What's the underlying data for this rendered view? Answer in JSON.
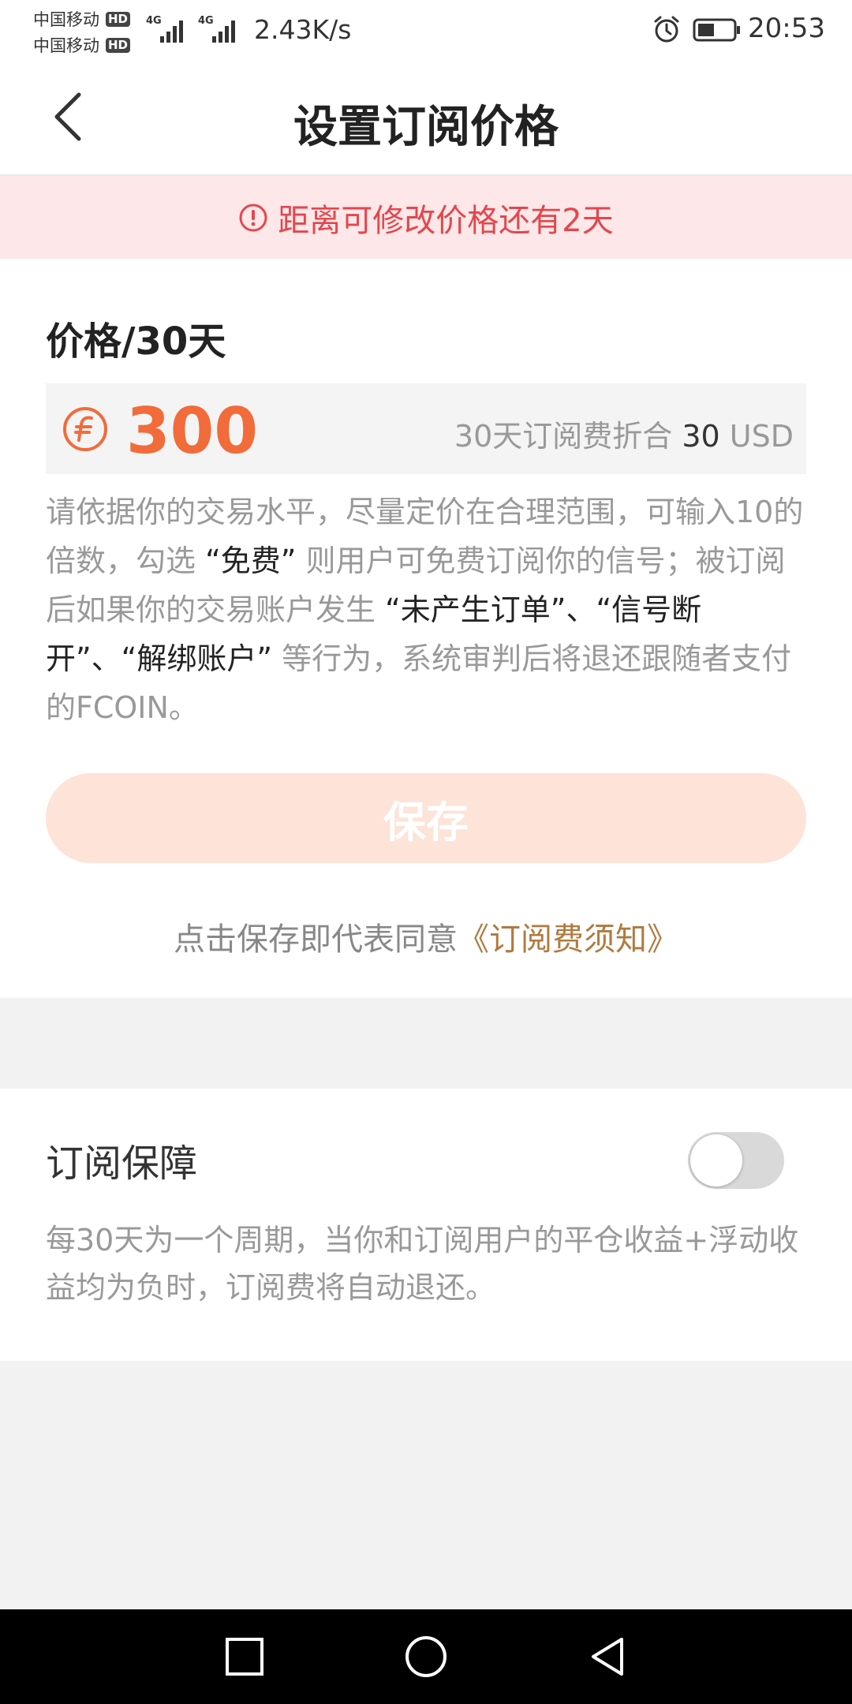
{
  "status_bar": {
    "carrier1": "中国移动",
    "carrier2": "中国移动",
    "hd_badge": "HD",
    "network": "4G",
    "net_speed": "2.43K/s",
    "time": "20:53",
    "icons": [
      "signal-icon",
      "alarm-icon",
      "battery-icon"
    ]
  },
  "header": {
    "title": "设置订阅价格",
    "back_icon": "chevron-left-icon"
  },
  "notice": {
    "text": "距离可修改价格还有2天",
    "icon": "exclamation-circle-icon",
    "color": "#e2474e"
  },
  "price": {
    "label": "价格/30天",
    "value": "300",
    "currency_icon": "fcoin-icon",
    "conversion_prefix": "30天订阅费折合 ",
    "conversion_amount": "30",
    "conversion_unit": " USD",
    "accent": "#f26b3a"
  },
  "description": {
    "p1": "请依据你的交易水平，尽量定价在合理范围，可输入10的倍数，勾选 ",
    "free": "“免费”",
    "p2": " 则用户可免费订阅你的信号；被订阅后如果你的交易账户发生 ",
    "conditions": "“未产生订单”、“信号断开”、“解绑账户”",
    "p3": " 等行为，系统审判后将退还跟随者支付的FCOIN。"
  },
  "save": {
    "label": "保存"
  },
  "agreement": {
    "prefix": "点击保存即代表同意",
    "link": "《订阅费须知》"
  },
  "guarantee": {
    "title": "订阅保障",
    "toggle_on": false,
    "description": "每30天为一个周期，当你和订阅用户的平仓收益+浮动收益均为负时，订阅费将自动退还。"
  },
  "system_nav": [
    "square-icon",
    "circle-icon",
    "triangle-back-icon"
  ]
}
